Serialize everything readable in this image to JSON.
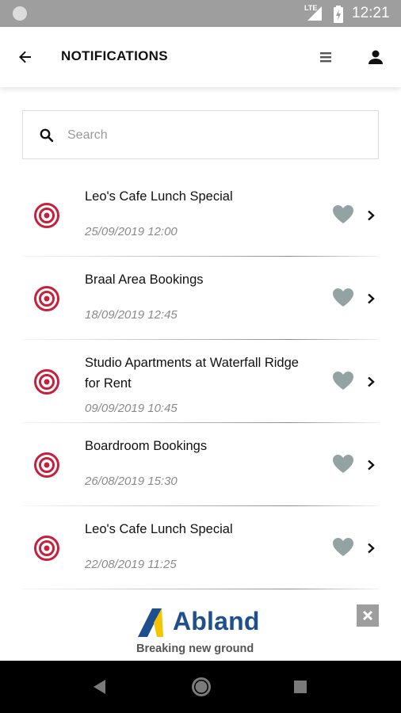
{
  "status_bar": {
    "time": "12:21",
    "network": "LTE"
  },
  "header": {
    "title": "NOTIFICATIONS"
  },
  "search": {
    "placeholder": "Search",
    "value": ""
  },
  "notifications": [
    {
      "title": "Leo's Cafe Lunch Special",
      "date": "25/09/2019 12:00"
    },
    {
      "title": "Braal Area Bookings",
      "date": "18/09/2019 12:45"
    },
    {
      "title": "Studio Apartments at Waterfall Ridge for Rent",
      "date": "09/09/2019 10:45"
    },
    {
      "title": "Boardroom Bookings",
      "date": "26/08/2019 15:30"
    },
    {
      "title": "Leo's Cafe Lunch Special",
      "date": "22/08/2019 11:25"
    }
  ],
  "ad": {
    "brand": "Abland",
    "tagline": "Breaking new ground"
  },
  "colors": {
    "accent_red": "#c8203c",
    "heart_gray": "#93a3a3",
    "brand_blue": "#1e4f8f",
    "brand_yellow": "#f5c400",
    "status_bar": "#9e9e9e"
  },
  "icons": {
    "header_left": "back-arrow-icon",
    "header_right": [
      "menu-icon",
      "user-icon"
    ],
    "search": "search-icon",
    "item_leading": "target-icon",
    "item_actions": [
      "heart-icon",
      "chevron-right-icon"
    ],
    "ad_close": "close-icon",
    "nav": [
      "nav-back-icon",
      "nav-home-icon",
      "nav-recents-icon"
    ]
  }
}
